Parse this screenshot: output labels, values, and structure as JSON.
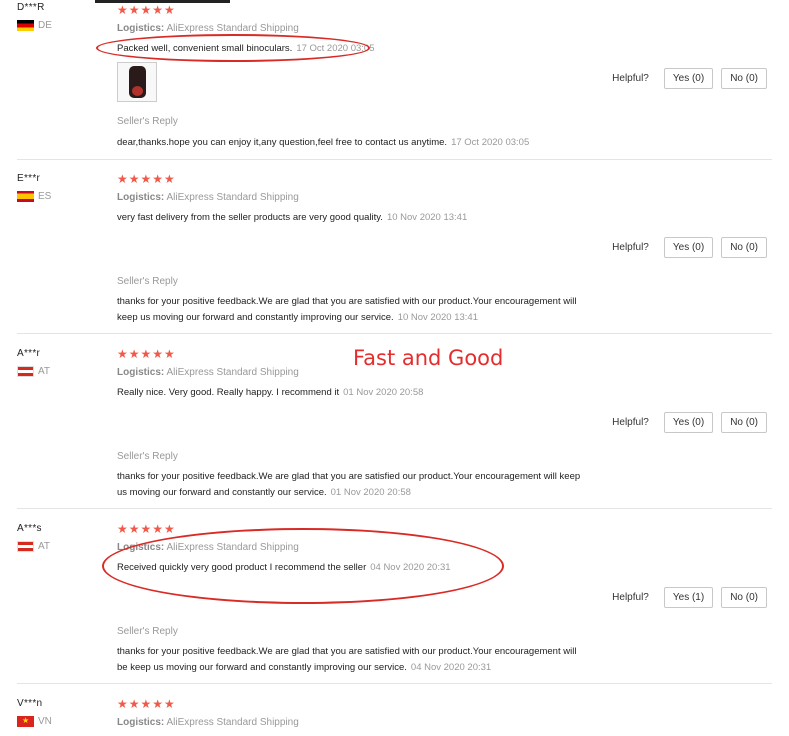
{
  "logistics_label": "Logistics:",
  "helpful_label": "Helpful?",
  "reply_label": "Seller's Reply",
  "stars": "★★★★★",
  "annotation": "Fast and Good",
  "colors": {
    "star": "#f15a4a",
    "annotation": "#e62d2d"
  },
  "reviews": [
    {
      "user": "D***R",
      "country": "DE",
      "flag_icon": "germany-flag-icon",
      "shipping": "AliExpress Standard Shipping",
      "text": "Packed well, convenient small binoculars.",
      "date": "17 Oct 2020 03:05",
      "yes": "Yes (0)",
      "no": "No (0)",
      "reply": "dear,thanks.hope you can enjoy it,any question,feel free to contact us anytime.",
      "reply_date": "17 Oct 2020 03:05"
    },
    {
      "user": "E***r",
      "country": "ES",
      "flag_icon": "spain-flag-icon",
      "shipping": "AliExpress Standard Shipping",
      "text": "very fast delivery from the seller products are very good quality.",
      "date": "10 Nov 2020 13:41",
      "yes": "Yes (0)",
      "no": "No (0)",
      "reply_1": "thanks for your positive feedback.We are glad that you are satisfied with our product.Your encouragement will",
      "reply_2": "keep us moving our forward and constantly improving our service.",
      "reply_date": "10 Nov 2020 13:41"
    },
    {
      "user": "A***r",
      "country": "AT",
      "flag_icon": "austria-flag-icon",
      "shipping": "AliExpress Standard Shipping",
      "text": "Really nice. Very good. Really happy. I recommend it",
      "date": "01 Nov 2020 20:58",
      "yes": "Yes (0)",
      "no": "No (0)",
      "reply_1": "thanks for your positive feedback.We are glad that you are satisfied our product.Your encouragement will keep",
      "reply_2": "us moving our forward and constantly our service.",
      "reply_date": "01 Nov 2020 20:58"
    },
    {
      "user": "A***s",
      "country": "AT",
      "flag_icon": "austria-flag-icon",
      "shipping": "AliExpress Standard Shipping",
      "text": "Received quickly very good product I recommend the seller",
      "date": "04 Nov 2020 20:31",
      "yes": "Yes (1)",
      "no": "No (0)",
      "reply_1": "thanks for your positive feedback.We are glad that you are satisfied with our product.Your encouragement will",
      "reply_2": "be keep us moving our forward and constantly improving our service.",
      "reply_date": "04 Nov 2020 20:31"
    },
    {
      "user": "V***n",
      "country": "VN",
      "flag_icon": "vietnam-flag-icon",
      "shipping": "AliExpress Standard Shipping"
    }
  ]
}
